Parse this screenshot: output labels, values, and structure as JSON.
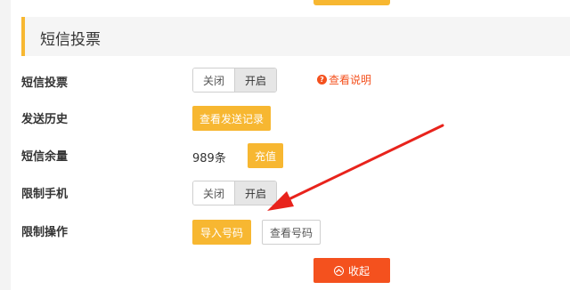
{
  "section": {
    "title": "短信投票"
  },
  "rows": {
    "sms_vote": {
      "label": "短信投票",
      "toggle_off": "关闭",
      "toggle_on": "开启",
      "selected": "开启",
      "help_icon": "?",
      "help_text": "查看说明"
    },
    "send_history": {
      "label": "发送历史",
      "button": "查看发送记录"
    },
    "sms_balance": {
      "label": "短信余量",
      "value": "989条",
      "recharge_button": "充值"
    },
    "restrict_phone": {
      "label": "限制手机",
      "toggle_off": "关闭",
      "toggle_on": "开启",
      "selected": "开启"
    },
    "restrict_action": {
      "label": "限制操作",
      "import_button": "导入号码",
      "view_button": "查看号码"
    }
  },
  "collapse_button": "收起",
  "colors": {
    "accent_yellow": "#f7b731",
    "accent_red": "#f4511e",
    "annotation_arrow": "#e8231c"
  }
}
